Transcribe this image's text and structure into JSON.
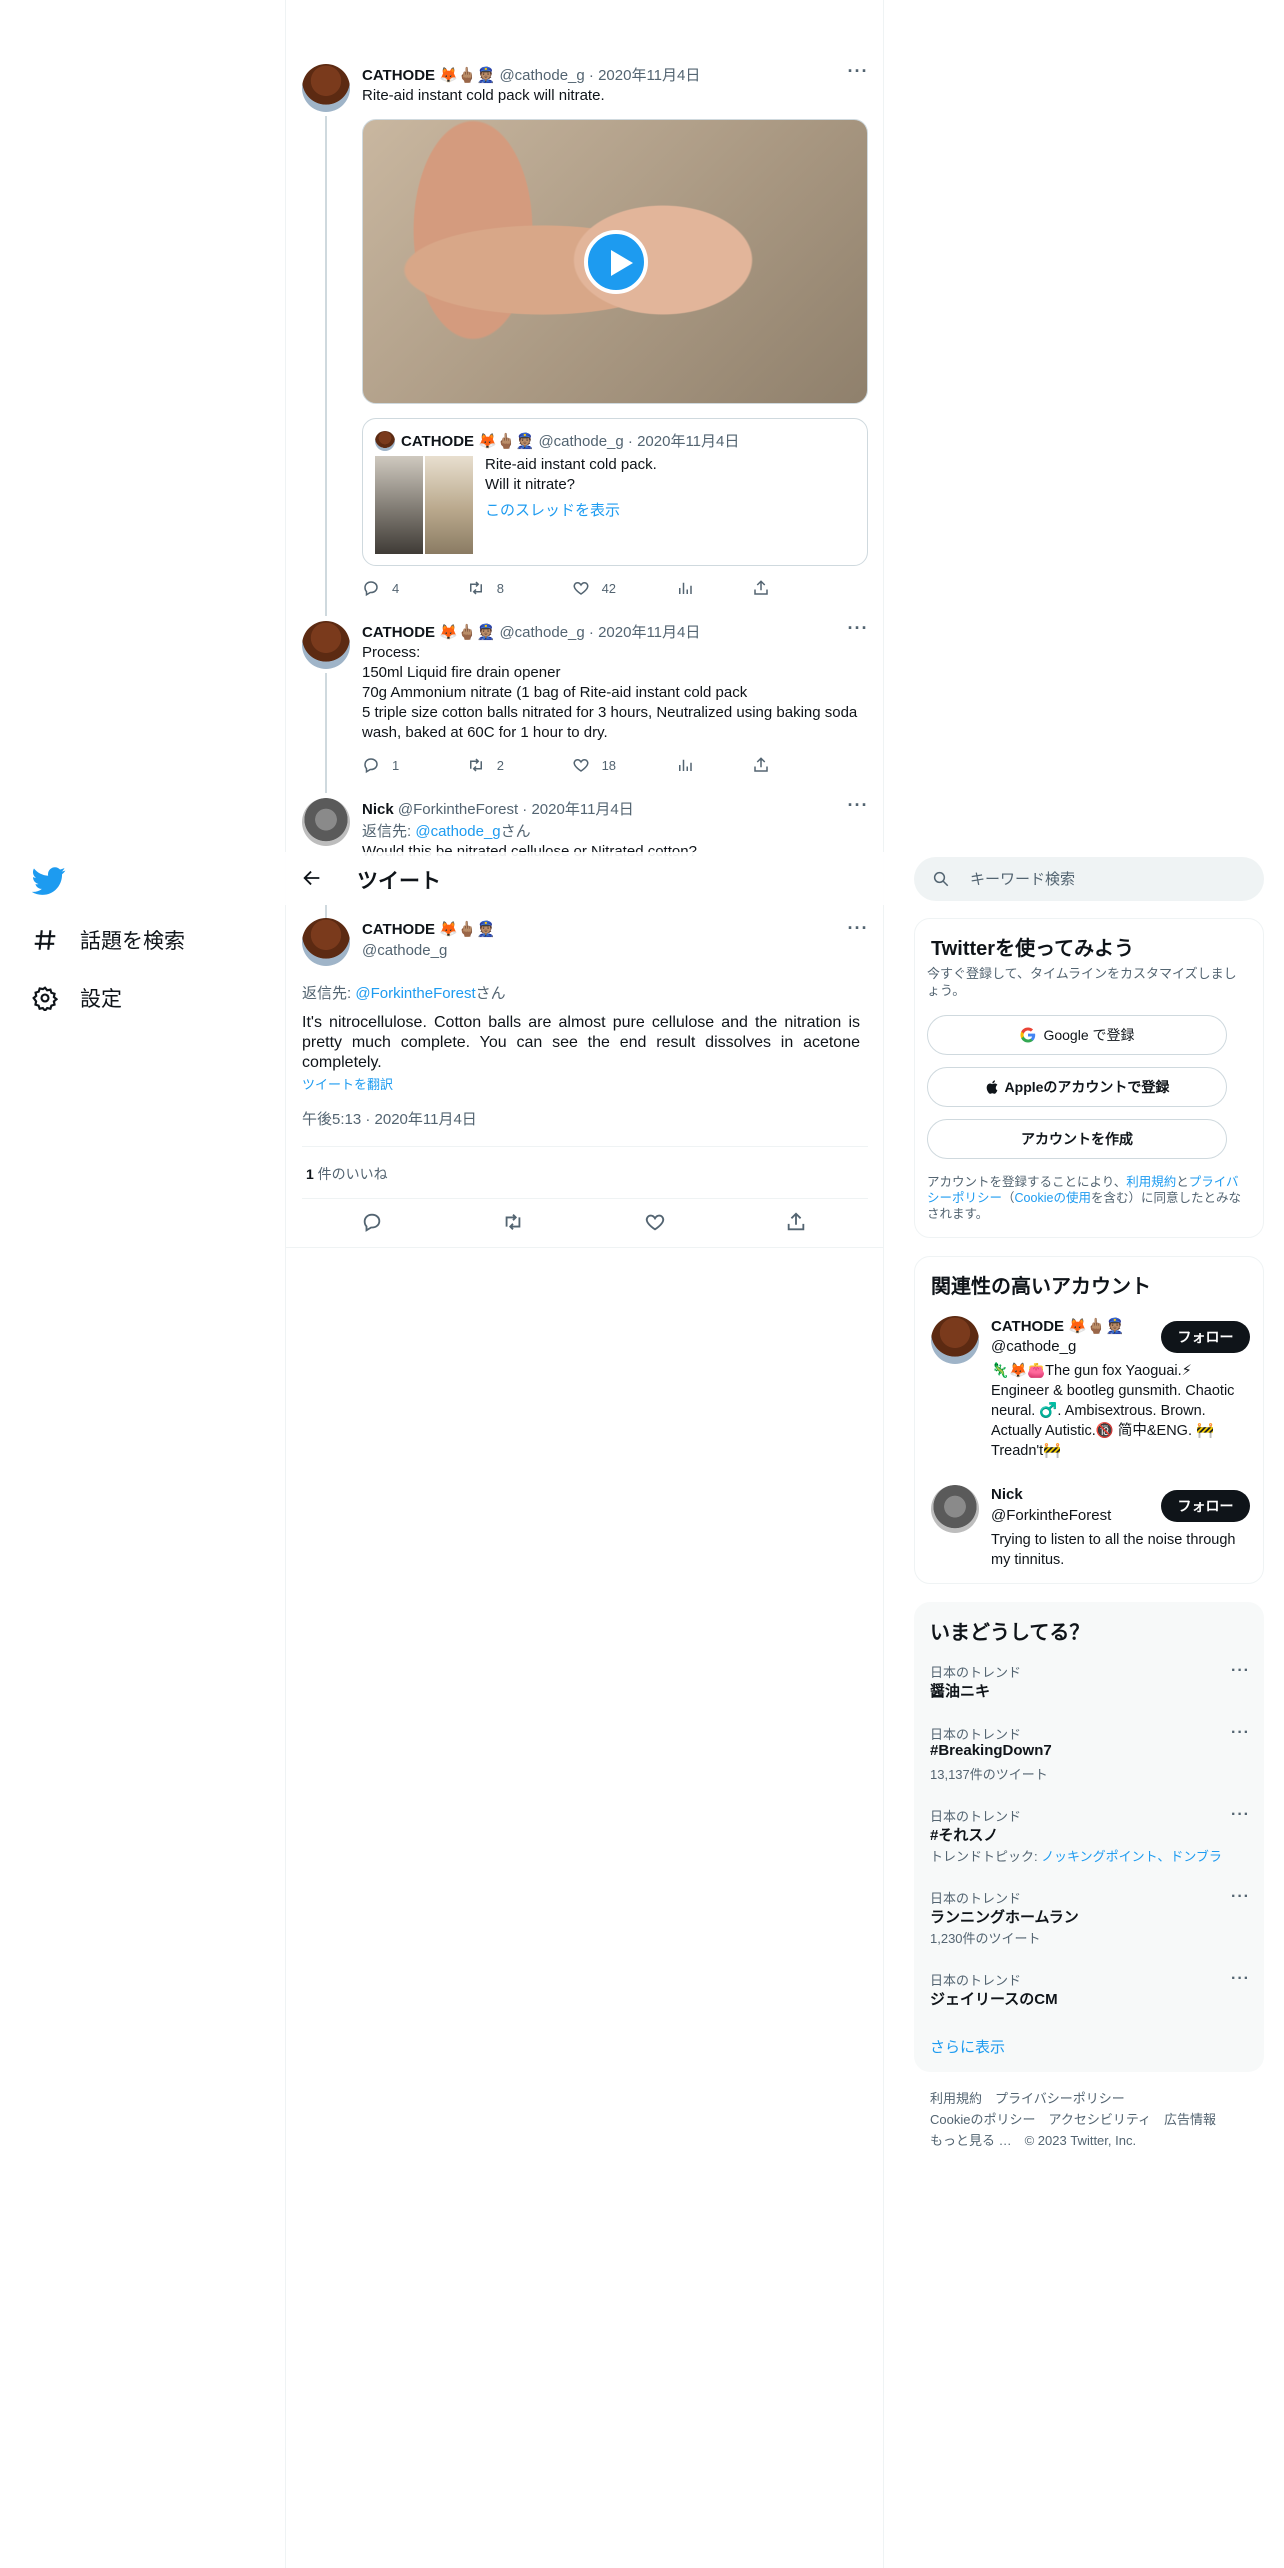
{
  "nav": {
    "items": [
      {
        "label": "話題を検索",
        "icon": "hashtag-icon"
      },
      {
        "label": "設定",
        "icon": "gear-icon"
      }
    ]
  },
  "thread": [
    {
      "name": "CATHODE",
      "emojis": "🦊🖕🏽👮🏽",
      "handle": "@cathode_g",
      "date": "2020年11月4日",
      "text": "Rite-aid instant cold pack will nitrate.",
      "quote": {
        "name": "CATHODE",
        "emojis": "🦊🖕🏽👮🏽",
        "handle": "@cathode_g",
        "date": "2020年11月4日",
        "text": "Rite-aid instant cold pack.\nWill it nitrate?",
        "link": "このスレッドを表示"
      },
      "replies": "4",
      "retweets": "8",
      "likes": "42"
    },
    {
      "name": "CATHODE",
      "emojis": "🦊🖕🏽👮🏽",
      "handle": "@cathode_g",
      "date": "2020年11月4日",
      "text": "Process:\n150ml Liquid fire drain opener\n70g Ammonium nitrate (1 bag of Rite-aid instant cold pack\n5 triple size cotton balls nitrated for 3 hours, Neutralized using baking soda\nwash, baked at 60C for 1 hour to dry.",
      "replies": "1",
      "retweets": "2",
      "likes": "18"
    },
    {
      "name": "Nick",
      "handle": "@ForkintheForest",
      "date": "2020年11月4日",
      "reply_prefix": "返信先: ",
      "reply_to": "@cathode_g",
      "reply_suffix": "さん",
      "text": "Would this be nitrated cellulose or Nitrated cotton?"
    }
  ],
  "topbar": {
    "title": "ツイート"
  },
  "main_tweet": {
    "name": "CATHODE",
    "emojis": "🦊🖕🏽👮🏽",
    "handle": "@cathode_g",
    "reply_prefix": "返信先: ",
    "reply_to": "@ForkintheForest",
    "reply_suffix": "さん",
    "text": "It's nitrocellulose. Cotton balls are almost pure cellulose and the nitration is pretty much complete. You can see the end result dissolves in acetone completely.",
    "translate": "ツイートを翻訳",
    "timestamp": "午後5:13 · 2020年11月4日",
    "like_count": "1",
    "like_label": " 件のいいね"
  },
  "search": {
    "placeholder": "キーワード検索"
  },
  "signup": {
    "title": "Twitterを使ってみよう",
    "subtitle": "今すぐ登録して、タイムラインをカスタマイズしましょう。",
    "google": "Google で登録",
    "apple": "Appleのアカウントで登録",
    "create": "アカウントを作成",
    "legal_1": "アカウントを登録することにより、",
    "terms": "利用規約",
    "and": "と",
    "privacy": "プライバシーポリシー",
    "open_paren": "（",
    "cookie": "Cookieの使用",
    "legal_2": "を含む）に同意したとみなされます。"
  },
  "related": {
    "title": "関連性の高いアカウント",
    "follow_label": "フォロー",
    "accounts": [
      {
        "name": "CATHODE",
        "emojis": "🦊🖕🏽👮🏽",
        "handle": "@cathode_g",
        "bio": "🦎🦊👛The gun fox Yaoguai.⚡ Engineer & bootleg gunsmith. Chaotic neural. ♂️. Ambisextrous. Brown. Actually Autistic.🔞 简中&ENG. 🚧Treadn't🚧"
      },
      {
        "name": "Nick",
        "handle": "@ForkintheForest",
        "bio": "Trying to listen to all the noise through my tinnitus."
      }
    ]
  },
  "trends": {
    "title": "いまどうしてる？",
    "items": [
      {
        "category": "日本のトレンド",
        "name": "醤油ニキ",
        "sub": ""
      },
      {
        "category": "日本のトレンド",
        "name": "#BreakingDown7",
        "sub": "13,137件のツイート"
      },
      {
        "category": "日本のトレンド",
        "name": "#それスノ",
        "sub_prefix": "トレンドトピック: ",
        "sub": "ノッキングポイント、ドンブラ"
      },
      {
        "category": "日本のトレンド",
        "name": "ランニングホームラン",
        "sub": "1,230件のツイート"
      },
      {
        "category": "日本のトレンド",
        "name": "ジェイリースのCM",
        "sub": ""
      }
    ],
    "show_more": "さらに表示"
  },
  "footer": {
    "line1": "利用規約　プライバシーポリシー",
    "line2": "Cookieのポリシー　アクセシビリティ　広告情報",
    "line3": "もっと見る …　© 2023 Twitter, Inc."
  },
  "colors": {
    "accent": "#1d9bf0",
    "text": "#0f1419",
    "muted": "#536471",
    "border": "#eff3f4"
  }
}
